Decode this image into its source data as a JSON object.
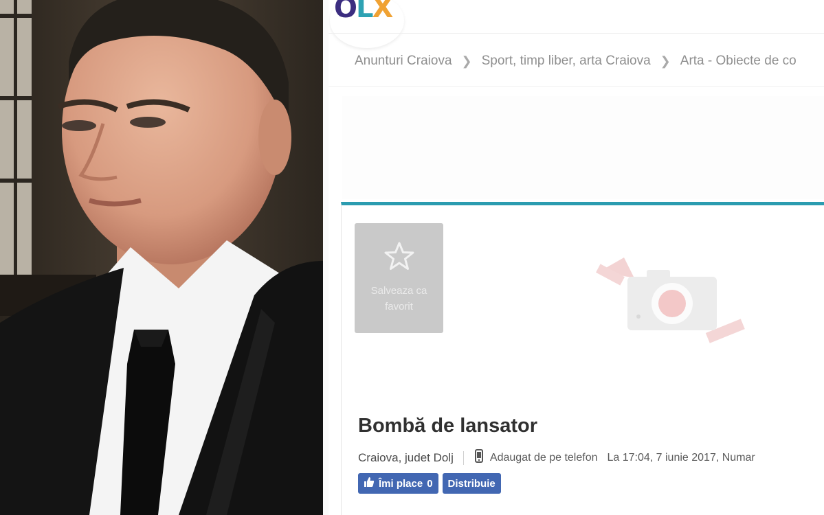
{
  "olx": {
    "logo": {
      "o": "O",
      "l": "L",
      "x": "X"
    },
    "breadcrumb": [
      "Anunturi Craiova",
      "Sport, timp liber, arta Craiova",
      "Arta - Obiecte de co"
    ],
    "favorite": {
      "label": "Salveaza ca favorit",
      "icon": "star-outline-icon"
    },
    "listing": {
      "title": "Bombă de lansator",
      "location": "Craiova, judet Dolj",
      "added_via": "Adaugat de pe telefon",
      "timestamp": "La 17:04, 7 iunie 2017, Numar"
    },
    "social": {
      "like_label": "Îmi place",
      "like_count": "0",
      "share_label": "Distribuie"
    },
    "colors": {
      "accent": "#2b9cb0",
      "facebook": "#4267b2",
      "favorite_bg": "#c9c9c9"
    }
  }
}
